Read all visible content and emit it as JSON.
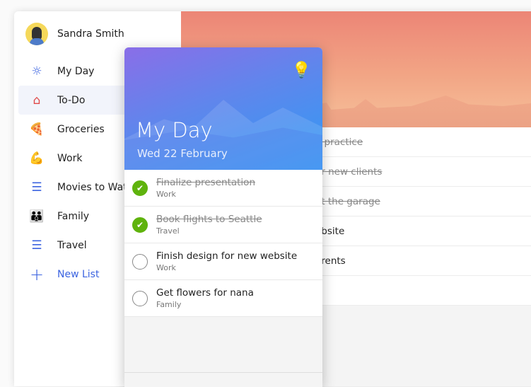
{
  "user": {
    "name": "Sandra Smith"
  },
  "sidebar": {
    "items": [
      {
        "label": "My Day",
        "icon": "☼",
        "color": "#3c64e0"
      },
      {
        "label": "To-Do",
        "icon": "⌂",
        "color": "#e04a4a"
      },
      {
        "label": "Groceries",
        "icon": "🍕"
      },
      {
        "label": "Work",
        "icon": "💪"
      },
      {
        "label": "Movies to Watch",
        "icon": "☰",
        "color": "#3c64e0"
      },
      {
        "label": "Family",
        "icon": "👪"
      },
      {
        "label": "Travel",
        "icon": "☰",
        "color": "#3c64e0"
      }
    ],
    "new_list": "New List"
  },
  "background_tasks": [
    {
      "title": "o practice",
      "done": true
    },
    {
      "title": "or new clients",
      "done": true
    },
    {
      "title": "at the garage",
      "done": true
    },
    {
      "title": "ebsite",
      "done": false
    },
    {
      "title": "arents",
      "done": false
    }
  ],
  "myday": {
    "title": "My Day",
    "date": "Wed 22 February",
    "tasks": [
      {
        "title": "Finalize presentation",
        "list": "Work",
        "done": true
      },
      {
        "title": "Book flights to Seattle",
        "list": "Travel",
        "done": true
      },
      {
        "title": "Finish design for new website",
        "list": "Work",
        "done": false
      },
      {
        "title": "Get flowers for nana",
        "list": "Family",
        "done": false
      }
    ]
  }
}
